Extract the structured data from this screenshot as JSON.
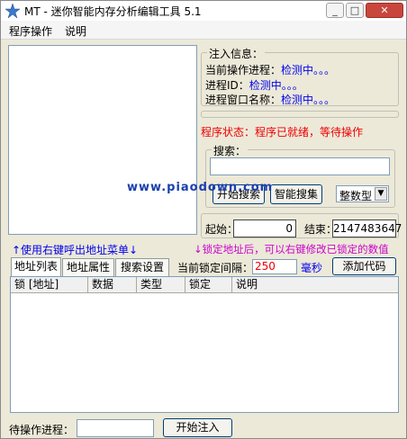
{
  "window": {
    "title": "MT - 迷你智能内存分析编辑工具 5.1"
  },
  "titlebar_buttons": {
    "minimize": "_",
    "maximize": "□",
    "close": "✕"
  },
  "menu": [
    {
      "label": "程序操作"
    },
    {
      "label": "说明"
    }
  ],
  "inject_info": {
    "title": "注入信息：",
    "current_process_label": "当前操作进程：",
    "current_process_value": "检测中。。。",
    "pid_label": "进程ID：",
    "pid_value": "检测中。。。",
    "window_name_label": "进程窗口名称：",
    "window_name_value": "检测中。。。"
  },
  "status": "程序状态：程序已就绪，等待操作",
  "search": {
    "title": "搜索：",
    "input_value": "",
    "start_button": "开始搜索",
    "smart_button": "智能搜集",
    "type_select": "整数型"
  },
  "watermark": "www.piaodown.com",
  "range": {
    "start_label": "起始：",
    "start_value": "0",
    "end_label": "结束：",
    "end_value": "2147483647"
  },
  "hints": {
    "left": "↑使用右键呼出地址菜单↓",
    "right": "↓锁定地址后，可以右键修改已锁定的数值"
  },
  "tabs": [
    {
      "label": "地址列表"
    },
    {
      "label": "地址属性"
    },
    {
      "label": "搜索设置"
    }
  ],
  "lock_interval": {
    "label": "当前锁定间隔：",
    "value": "250",
    "unit": "毫秒"
  },
  "add_code_button": "添加代码",
  "table": {
    "columns": [
      "锁 [地址]",
      "数据",
      "类型",
      "锁定",
      "说明"
    ]
  },
  "footer": {
    "pending_label": "待操作进程：",
    "pending_value": "",
    "inject_button": "开始注入"
  }
}
